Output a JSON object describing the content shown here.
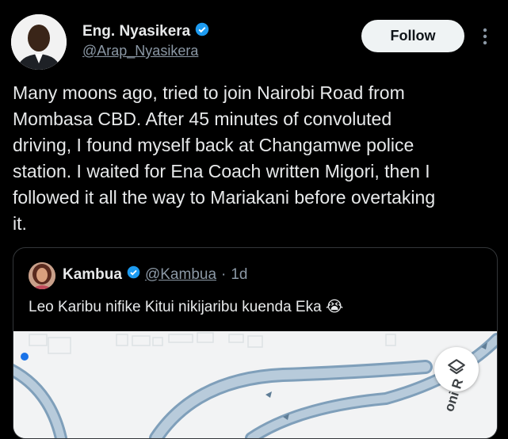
{
  "author": {
    "display_name": "Eng. Nyasikera",
    "handle": "@Arap_Nyasikera"
  },
  "follow_label": "Follow",
  "tweet": {
    "text": "Many moons ago, tried to join Nairobi Road from\nMombasa CBD. After 45 minutes of convoluted\ndriving, I found myself back at Changamwe police\nstation. I waited for Ena Coach written Migori, then I\nfollowed it all the way to Mariakani before overtaking\nit."
  },
  "quote": {
    "display_name": "Kambua",
    "handle": "@Kambua",
    "separator": "·",
    "time": "1d",
    "text": "Leo Karibu nifike Kitui nikijaribu kuenda Eka 😭",
    "map": {
      "road_label": "oni R"
    }
  },
  "colors": {
    "background": "#000000",
    "verified": "#1d9bf0",
    "road": "#7f9fba",
    "map_bg": "#f2f3f4"
  }
}
